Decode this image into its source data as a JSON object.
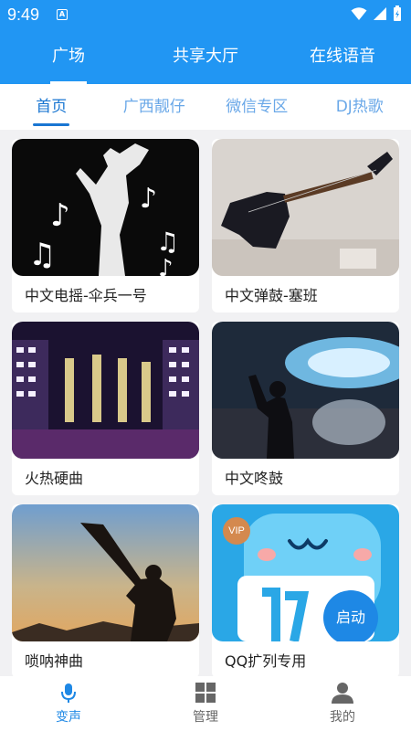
{
  "status_bar": {
    "time": "9:49",
    "badge": "A"
  },
  "main_tabs": [
    {
      "label": "广场",
      "active": true
    },
    {
      "label": "共享大厅",
      "active": false
    },
    {
      "label": "在线语音",
      "active": false
    }
  ],
  "sub_tabs": [
    {
      "label": "首页",
      "active": true
    },
    {
      "label": "广西靓仔",
      "active": false
    },
    {
      "label": "微信专区",
      "active": false
    },
    {
      "label": "DJ热歌",
      "active": false
    }
  ],
  "cards": [
    {
      "title": "中文电摇-伞兵一号"
    },
    {
      "title": "中文弹鼓-塞班"
    },
    {
      "title": "火热硬曲"
    },
    {
      "title": "中文咚鼓"
    },
    {
      "title": "唢呐神曲"
    },
    {
      "title": "QQ扩列专用",
      "vip_label": "VIP",
      "launch_label": "启动"
    }
  ],
  "bottom_nav": [
    {
      "label": "变声",
      "icon": "microphone-icon",
      "active": true
    },
    {
      "label": "管理",
      "icon": "grid-icon",
      "active": false
    },
    {
      "label": "我的",
      "icon": "person-icon",
      "active": false
    }
  ],
  "colors": {
    "primary": "#2196f3",
    "accent": "#1e88e5",
    "subtab_inactive": "#6aa8e8",
    "vip": "#d4894e"
  }
}
